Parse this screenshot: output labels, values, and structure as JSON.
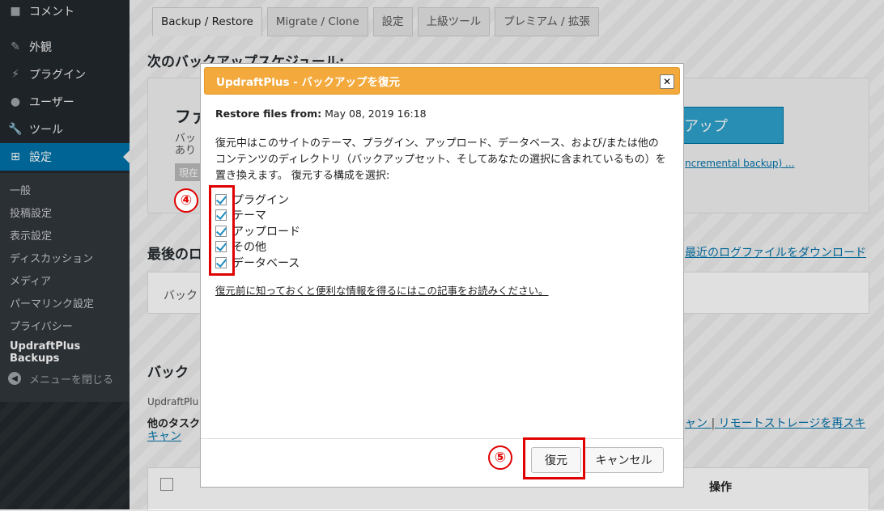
{
  "sidebar": {
    "items": [
      {
        "label": "コメント",
        "icon": "comment-icon"
      },
      {
        "label": "外観",
        "icon": "brush-icon"
      },
      {
        "label": "プラグイン",
        "icon": "plugin-icon"
      },
      {
        "label": "ユーザー",
        "icon": "user-icon"
      },
      {
        "label": "ツール",
        "icon": "wrench-icon"
      },
      {
        "label": "設定",
        "icon": "settings-icon",
        "active": true
      }
    ],
    "subitems": [
      "一般",
      "投稿設定",
      "表示設定",
      "ディスカッション",
      "メディア",
      "パーマリンク設定",
      "プライバシー",
      "UpdraftPlus Backups"
    ],
    "collapse_label": "メニューを閉じる"
  },
  "tabs": [
    "Backup / Restore",
    "Migrate / Clone",
    "設定",
    "上級ツール",
    "プレミアム / 拡張"
  ],
  "background": {
    "schedule_heading": "次のバックアップスケジュール:",
    "files_label": "ファ",
    "files_sub1": "バッ",
    "files_sub2": "あり",
    "current_label": "現在",
    "backup_now_button": "ックアップ",
    "incremental_link": "ncremental backup) ...",
    "last_log_heading": "最後のロ",
    "download_log_link": "最近のログファイルをダウンロード",
    "last_log_text": "バック",
    "existing_heading": "バック",
    "updraftplus_text": "UpdraftPlu",
    "other_tasks_text": "他のタスク",
    "rescan_link_part1": "ャン",
    "rescan_link_part2": "リモートストレージを再スキ",
    "rescan_link_part3": "キャン",
    "table_action_header": "操作"
  },
  "dialog": {
    "title": "UpdraftPlus - バックアップを復元",
    "restore_from_label": "Restore files from:",
    "restore_from_value": "May 08, 2019 16:18",
    "description": "復元中はこのサイトのテーマ、プラグイン、アップロード、データベース、および/または他のコンテンツのディレクトリ（バックアップセット、そしてあなたの選択に含まれているもの）を置き換えます。 復元する構成を選択:",
    "options": [
      {
        "label": "プラグイン",
        "checked": true
      },
      {
        "label": "テーマ",
        "checked": true
      },
      {
        "label": "アップロード",
        "checked": true
      },
      {
        "label": "その他",
        "checked": true
      },
      {
        "label": "データベース",
        "checked": true
      }
    ],
    "info_link": "復元前に知っておくと便利な情報を得るにはこの記事をお読みください。",
    "restore_button": "復元",
    "cancel_button": "キャンセル"
  },
  "annotations": {
    "step4": "④",
    "step5": "⑤"
  }
}
